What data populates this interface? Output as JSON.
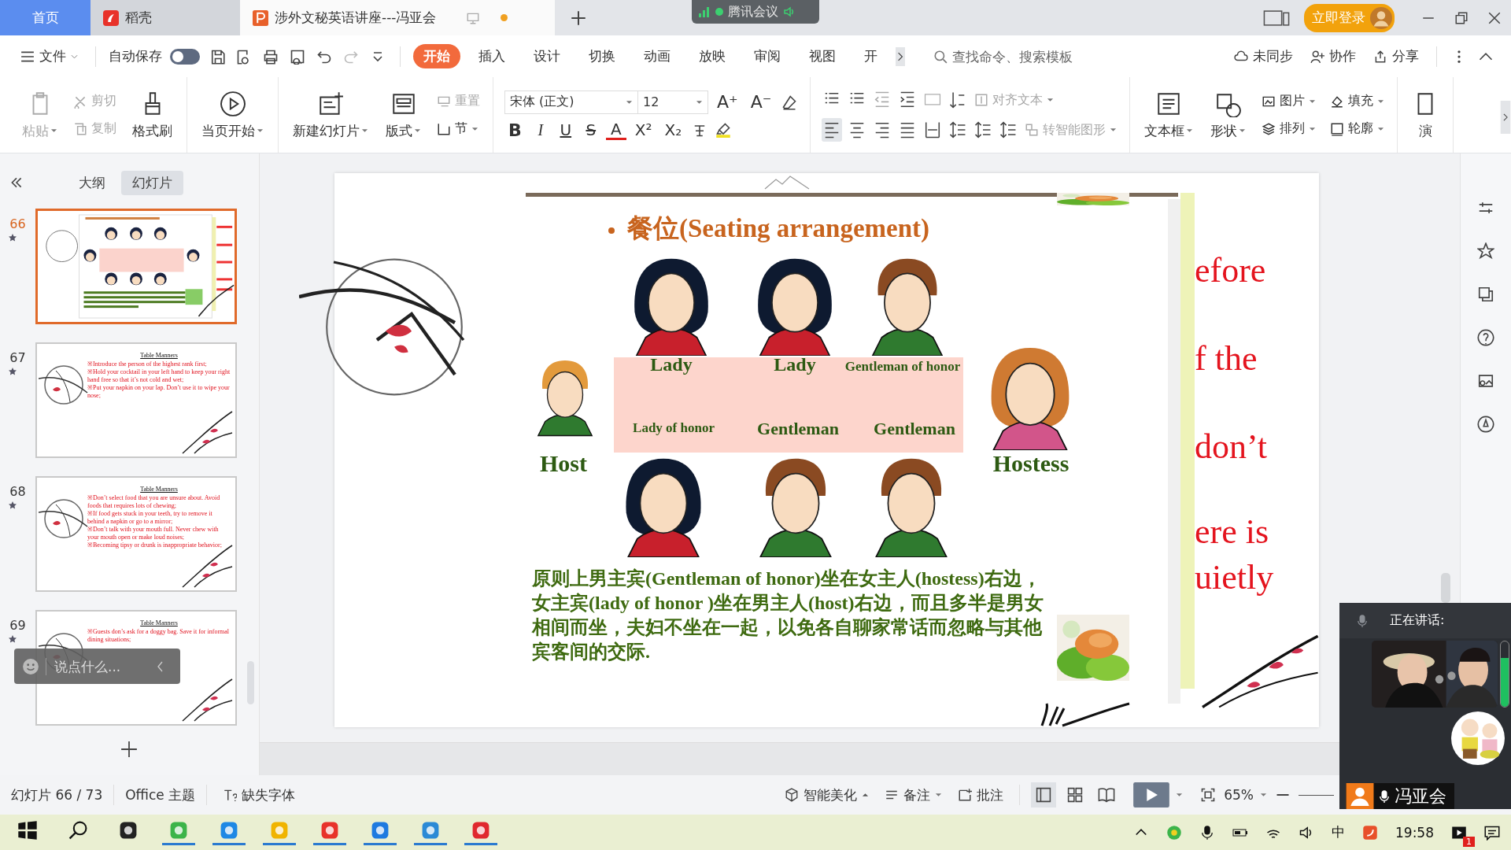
{
  "title_bar": {
    "tabs": [
      {
        "label": "首页",
        "kind": "home",
        "selected": false
      },
      {
        "label": "稻壳",
        "kind": "docer",
        "selected": false
      },
      {
        "label": "涉外文秘英语讲座---冯亚会",
        "kind": "document",
        "selected": true
      }
    ],
    "meeting_badge": "腾讯会议",
    "login_button": "立即登录"
  },
  "toolbar": {
    "file_menu": "文件",
    "autosave_label": "自动保存",
    "autosave_on": false
  },
  "ribbon_tabs": [
    {
      "label": "开始",
      "selected": true
    },
    {
      "label": "插入",
      "selected": false
    },
    {
      "label": "设计",
      "selected": false
    },
    {
      "label": "切换",
      "selected": false
    },
    {
      "label": "动画",
      "selected": false
    },
    {
      "label": "放映",
      "selected": false
    },
    {
      "label": "审阅",
      "selected": false
    },
    {
      "label": "视图",
      "selected": false
    },
    {
      "label": "开",
      "selected": false
    }
  ],
  "search": {
    "placeholder": "查找命令、搜索模板"
  },
  "top_actions": [
    "未同步",
    "协作",
    "分享"
  ],
  "ribbon": [
    {
      "kind": "tools",
      "columns": [
        {
          "kind": "large",
          "items": [
            {
              "label": "粘贴",
              "disabled": true,
              "dropdown": true
            }
          ]
        },
        {
          "kind": "stack",
          "items": [
            {
              "label": "剪切",
              "disabled": true,
              "dropdown": false
            },
            {
              "label": "复制",
              "disabled": true,
              "dropdown": false
            }
          ]
        },
        {
          "kind": "large",
          "items": [
            {
              "label": "格式刷",
              "disabled": false,
              "dropdown": false
            }
          ]
        }
      ]
    },
    {
      "kind": "tools",
      "columns": [
        {
          "kind": "large",
          "items": [
            {
              "label": "当页开始",
              "disabled": false,
              "dropdown": true
            }
          ]
        }
      ]
    },
    {
      "kind": "tools",
      "columns": [
        {
          "kind": "large",
          "items": [
            {
              "label": "新建幻灯片",
              "disabled": false,
              "dropdown": true
            }
          ]
        },
        {
          "kind": "large",
          "items": [
            {
              "label": "版式",
              "disabled": false,
              "dropdown": true
            }
          ]
        },
        {
          "kind": "stack",
          "items": [
            {
              "label": "重置",
              "disabled": true,
              "dropdown": false
            },
            {
              "label": "节",
              "disabled": false,
              "dropdown": true
            }
          ]
        }
      ]
    },
    {
      "kind": "font",
      "font": "宋体 (正文)",
      "size": "12",
      "size_buttons": [
        "A⁺",
        "A⁻"
      ],
      "styles": [
        "B",
        "I",
        "U",
        "S",
        "A",
        "X²",
        "X₂"
      ]
    },
    {
      "kind": "paragraph",
      "items": [
        {
          "label": "对齐文本",
          "disabled": true,
          "dropdown": true
        },
        {
          "label": "转智能图形",
          "disabled": true,
          "dropdown": true
        }
      ]
    },
    {
      "kind": "tools",
      "columns": [
        {
          "kind": "large",
          "items": [
            {
              "label": "文本框",
              "disabled": false,
              "dropdown": true
            }
          ]
        },
        {
          "kind": "large",
          "items": [
            {
              "label": "形状",
              "disabled": false,
              "dropdown": true
            }
          ]
        },
        {
          "kind": "stack",
          "items": [
            {
              "label": "图片",
              "disabled": false,
              "dropdown": true
            },
            {
              "label": "排列",
              "disabled": false,
              "dropdown": true
            }
          ]
        },
        {
          "kind": "stack",
          "items": [
            {
              "label": "填充",
              "disabled": false,
              "dropdown": true
            },
            {
              "label": "轮廓",
              "disabled": false,
              "dropdown": true
            }
          ]
        }
      ]
    },
    {
      "kind": "tools",
      "columns": [
        {
          "kind": "large",
          "items": [
            {
              "label": "演",
              "disabled": false,
              "dropdown": false
            }
          ]
        }
      ]
    }
  ],
  "left_panel": {
    "tabs": [
      {
        "label": "大纲",
        "selected": false
      },
      {
        "label": "幻灯片",
        "selected": true
      }
    ],
    "thumbnails": [
      {
        "number": "66",
        "selected": true,
        "kind": "seating"
      },
      {
        "number": "67",
        "selected": false,
        "kind": "text",
        "heading": "Table Manners",
        "lines": [
          "※Introduce the person of the highest rank first;",
          "※Hold your cocktail in your left hand to keep your right hand free so that it’s not cold and wet;",
          "※Put your napkin on your lap. Don’t use it to wipe your nose;"
        ]
      },
      {
        "number": "68",
        "selected": false,
        "kind": "text",
        "heading": "Table Manners",
        "lines": [
          "※Don’t select food that you are unsure about. Avoid foods that requires lots of chewing;",
          "※If food gets stuck in your teeth, try to remove it behind a napkin or go to a mirror;",
          "※Don’t talk with your mouth full. Never chew with your mouth open or make loud noises;",
          "※Becoming tipsy or drunk is inappropriate behavior;"
        ]
      },
      {
        "number": "69",
        "selected": false,
        "kind": "text",
        "heading": "Table Manners",
        "lines": [
          "※Guests don’s ask for a doggy bag. Save it for informal dining situations;"
        ]
      }
    ]
  },
  "chat": {
    "placeholder": "说点什么..."
  },
  "slide": {
    "title": "餐位(Seating arrangement)",
    "people": [
      {
        "label": "Lady",
        "kind": "woman"
      },
      {
        "label": "Lady",
        "kind": "woman"
      },
      {
        "label": "Gentleman of honor",
        "kind": "man"
      },
      {
        "label": "Host",
        "kind": "fair_man"
      },
      {
        "label": "Hostess",
        "kind": "fair_woman"
      },
      {
        "label": "Lady of honor",
        "kind": "woman"
      },
      {
        "label": "Gentleman",
        "kind": "man"
      },
      {
        "label": "Gentleman",
        "kind": "man"
      }
    ],
    "paragraph": "原则上男主宾(Gentleman of honor)坐在女主人(hostess)右边，女主宾(lady of honor )坐在男主人(host)右边，而且多半是男女相间而坐，夫妇不坐在一起，以免各自聊家常话而忽略与其他宾客间的交际.",
    "side_text": [
      "efore",
      "f the",
      "don’t",
      "ere is",
      "uietly"
    ]
  },
  "status_bar": {
    "slide_counter": "幻灯片 66 / 73",
    "theme": "Office 主题",
    "missing_font": "缺失字体",
    "beautify": "智能美化",
    "notes": "备注",
    "comments": "批注",
    "views": [
      {
        "selected": true
      },
      {
        "selected": false
      },
      {
        "selected": false
      }
    ],
    "zoom": "65%"
  },
  "meeting_window": {
    "status": "正在讲话:",
    "speaker": "冯亚会",
    "level": 0.75
  },
  "taskbar": {
    "ime": "中",
    "time": "19:58",
    "badge": "1"
  }
}
